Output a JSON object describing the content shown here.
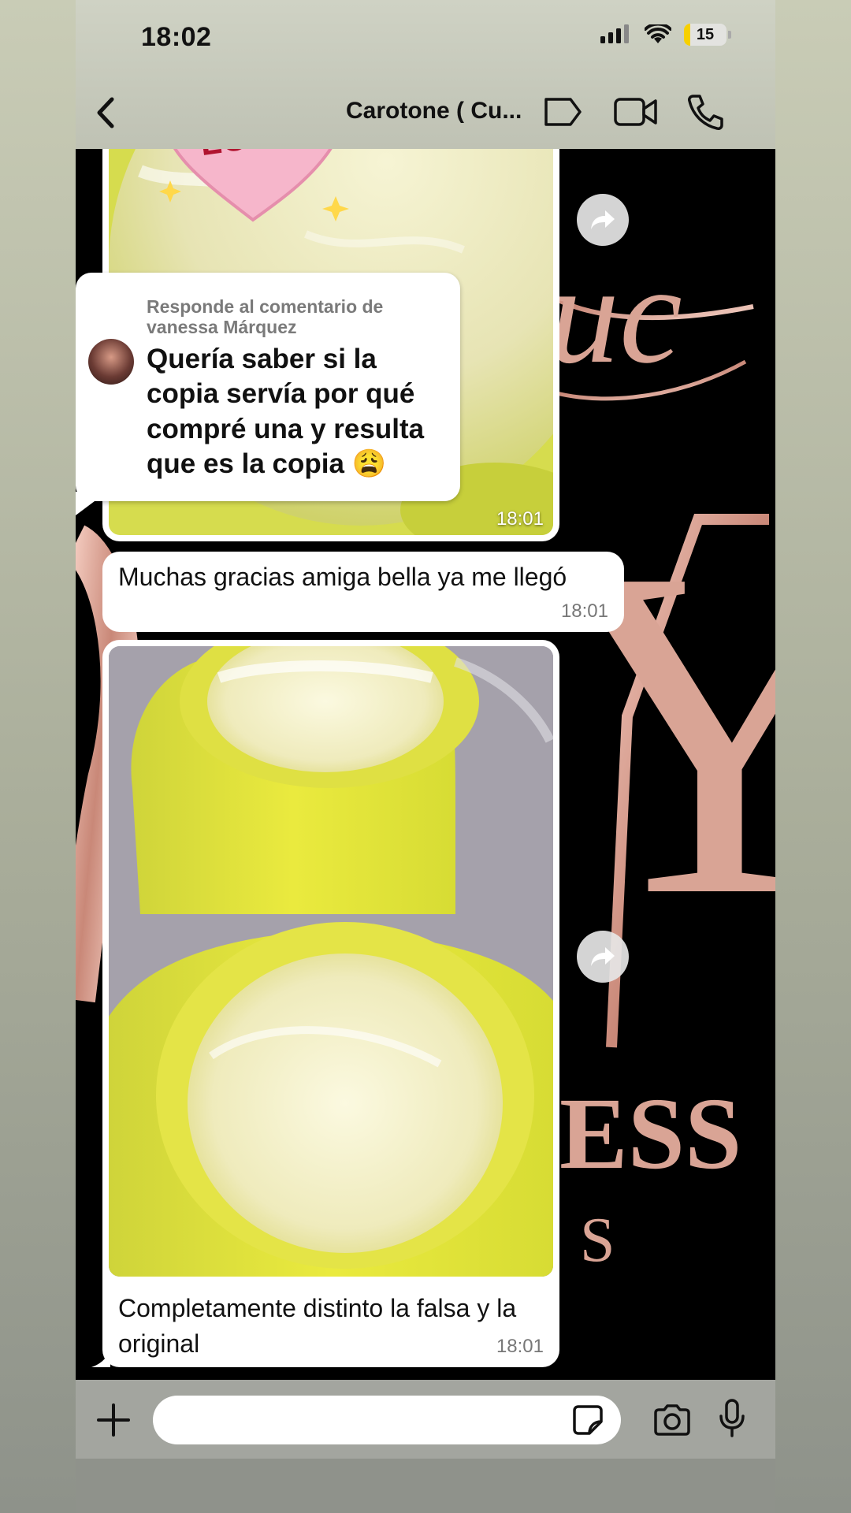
{
  "status_bar": {
    "time": "18:02",
    "battery": "15",
    "battery_level": 0.15
  },
  "header": {
    "contact_name": "Carotone ( Cu..."
  },
  "sticker": {
    "text": "LOVE"
  },
  "wallpaper": {
    "letters_large": "Y",
    "letters_mid": "ESS",
    "letters_small": "S",
    "script": "uc"
  },
  "messages": [
    {
      "type": "image_with_reply",
      "reply_card": {
        "label": "Responde al comentario de vanessa Márquez",
        "text": "Quería saber si la copia servía por qué compré una y resulta que es la copia 😩"
      },
      "time": "18:01"
    },
    {
      "type": "text",
      "text": "Muchas gracias amiga bella ya me llegó",
      "time": "18:01"
    },
    {
      "type": "image",
      "caption": "Completamente distinto la falsa y la original",
      "time": "18:01"
    }
  ],
  "composer": {
    "placeholder": ""
  },
  "colors": {
    "yellow": "#e4e040",
    "cream": "#f3f1c6",
    "rose_gold": "#d9a495"
  }
}
